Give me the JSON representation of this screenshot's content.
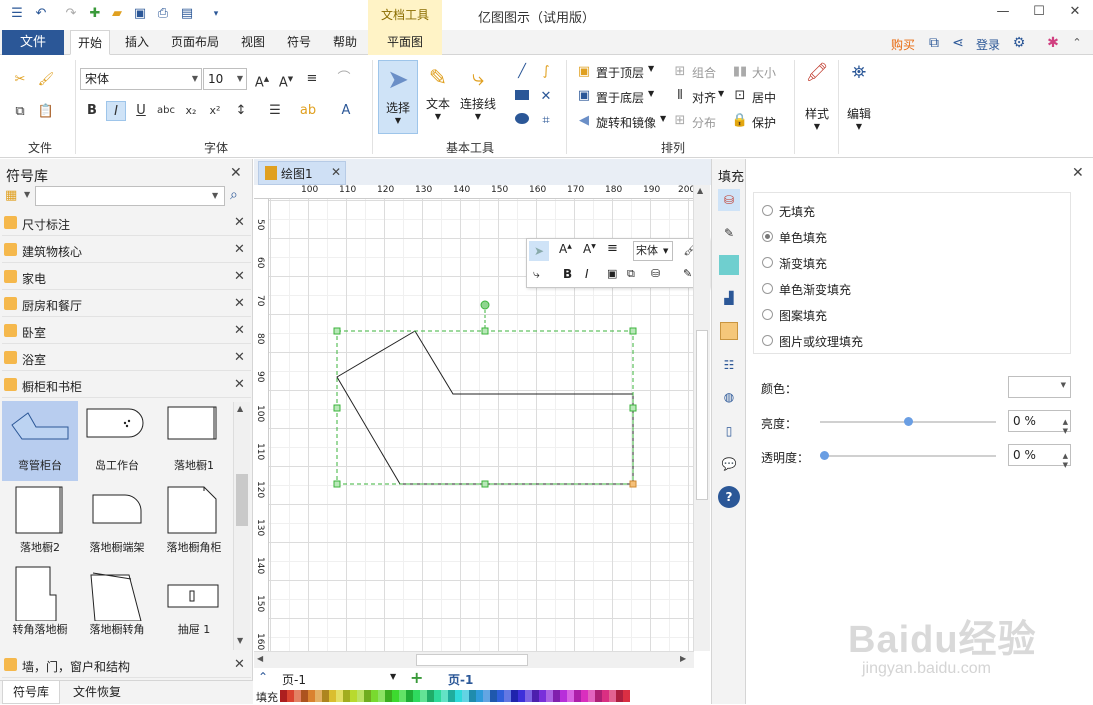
{
  "app": {
    "title": "亿图图示（试用版）",
    "context_tab_group": "文档工具"
  },
  "ribbon": {
    "file_tab": "文件",
    "tabs": [
      "开始",
      "插入",
      "页面布局",
      "视图",
      "符号",
      "帮助",
      "平面图"
    ],
    "active_tab": "开始",
    "buy": "购买",
    "login": "登录",
    "groups": {
      "file": "文件",
      "font": "字体",
      "basic_tools": "基本工具",
      "arrange": "排列"
    },
    "font_name": "宋体",
    "font_size": "10",
    "tool_select": "选择",
    "tool_text": "文本",
    "tool_connector": "连接线",
    "arrange_items": {
      "bring_front": "置于顶层",
      "send_back": "置于底层",
      "rotate_mirror": "旋转和镜像",
      "group": "组合",
      "align": "对齐",
      "distribute": "分布",
      "size": "大小",
      "center": "居中",
      "protect": "保护"
    },
    "style": "样式",
    "edit": "编辑"
  },
  "library": {
    "title": "符号库",
    "search_placeholder": "",
    "categories": [
      "尺寸标注",
      "建筑物核心",
      "家电",
      "厨房和餐厅",
      "卧室",
      "浴室",
      "橱柜和书柜"
    ],
    "shapes": [
      {
        "label": "弯管柜台",
        "selected": true
      },
      {
        "label": "岛工作台"
      },
      {
        "label": "落地橱1"
      },
      {
        "label": "落地橱2"
      },
      {
        "label": "落地橱端架"
      },
      {
        "label": "落地橱角柜"
      },
      {
        "label": "转角落地橱"
      },
      {
        "label": "落地橱转角"
      },
      {
        "label": "抽屉 1"
      }
    ],
    "bottom_category": "墙，门，窗户和结构",
    "bottom_tabs": [
      "符号库",
      "文件恢复"
    ]
  },
  "document": {
    "tab": "绘图1",
    "ruler_h": [
      "100",
      "110",
      "120",
      "130",
      "140",
      "150",
      "160",
      "170",
      "180",
      "190",
      "200"
    ],
    "ruler_v": [
      "50",
      "60",
      "70",
      "80",
      "90",
      "100",
      "110",
      "120",
      "130",
      "140",
      "150",
      "160"
    ],
    "page_selector": "页-1",
    "page_tab": "页-1",
    "color_bar_label": "填充"
  },
  "minibar": {
    "font": "宋体"
  },
  "fill_panel": {
    "title": "填充",
    "options": [
      {
        "label": "无填充",
        "checked": false
      },
      {
        "label": "单色填充",
        "checked": true
      },
      {
        "label": "渐变填充",
        "checked": false
      },
      {
        "label": "单色渐变填充",
        "checked": false
      },
      {
        "label": "图案填充",
        "checked": false
      },
      {
        "label": "图片或纹理填充",
        "checked": false
      }
    ],
    "color_label": "颜色：",
    "brightness_label": "亮度：",
    "brightness_value": "0 %",
    "brightness_level": 0.5,
    "transparency_label": "透明度：",
    "transparency_value": "0 %",
    "transparency_level": 0.0
  },
  "watermark": {
    "brand": "Baidu经验",
    "url": "jingyan.baidu.com"
  },
  "colors": {
    "accent": "#2b5797",
    "context_tab": "#fff3c6",
    "selection_handle": "#3bb33b",
    "buy": "#e8690e"
  }
}
